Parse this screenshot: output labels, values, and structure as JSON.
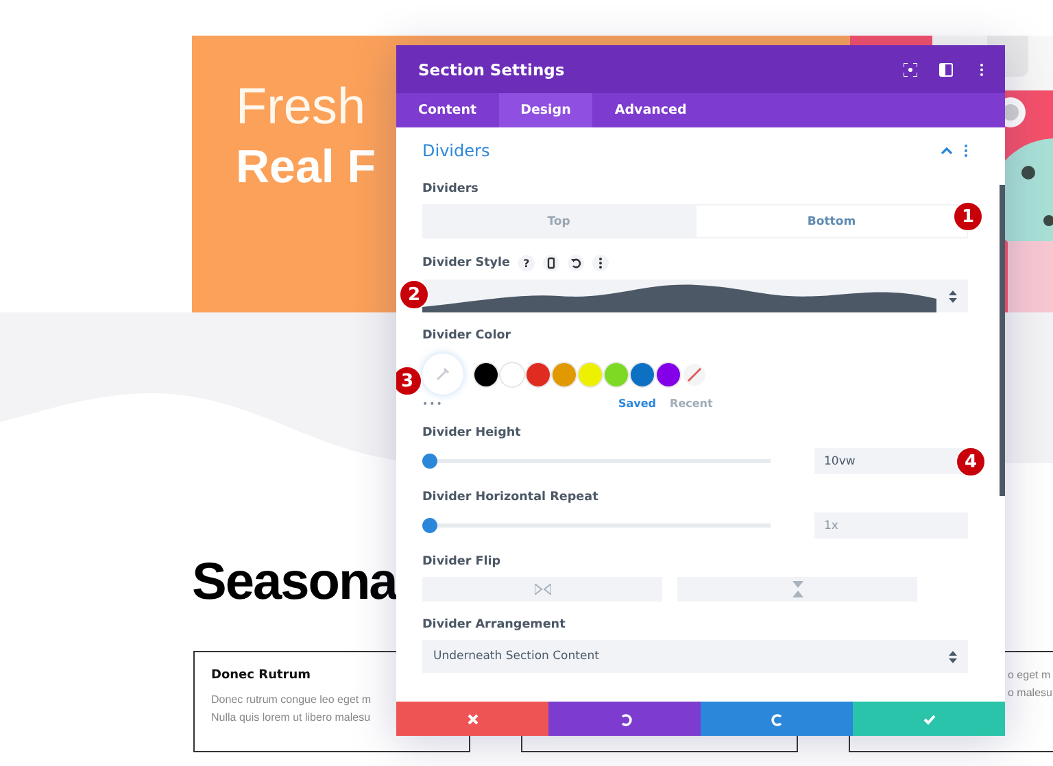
{
  "hero": {
    "title_light": "Fresh",
    "title_bold": "Real F"
  },
  "heading": "Seasona",
  "cards": [
    {
      "kind": "text",
      "title": "Donec Rutrum",
      "lines": [
        "Donec rutrum congue leo eget m",
        "Nulla quis lorem ut libero malesu"
      ]
    },
    {
      "kind": "blank"
    },
    {
      "kind": "text",
      "lines": [
        "o eget m",
        "o malesu"
      ]
    }
  ],
  "modal": {
    "title": "Section Settings",
    "tabs": [
      {
        "label": "Content",
        "selected": false
      },
      {
        "label": "Design",
        "selected": true
      },
      {
        "label": "Advanced",
        "selected": false
      }
    ],
    "section": {
      "title": "Dividers",
      "expanded": true
    },
    "fields": [
      {
        "kind": "toggle",
        "label": "Dividers",
        "options": [
          {
            "label": "Top",
            "selected": false
          },
          {
            "label": "Bottom",
            "selected": true
          }
        ],
        "marker": "1"
      },
      {
        "kind": "wave",
        "label": "Divider Style",
        "help": "?",
        "marker": "2"
      },
      {
        "kind": "colors",
        "label": "Divider Color",
        "more": "•••",
        "marker": "3",
        "swatches": [
          {
            "color": "#000000"
          },
          {
            "color": "#ffffff"
          },
          {
            "color": "#e02b20"
          },
          {
            "color": "#e09900"
          },
          {
            "color": "#edf000"
          },
          {
            "color": "#7cda24"
          },
          {
            "color": "#0c71c3"
          },
          {
            "color": "#8300e9"
          }
        ],
        "tabs": [
          {
            "label": "Saved",
            "selected": true
          },
          {
            "label": "Recent",
            "selected": false
          }
        ]
      },
      {
        "kind": "slider",
        "label": "Divider Height",
        "level": 0.02,
        "value": "10vw",
        "dim": false,
        "marker": "4"
      },
      {
        "kind": "slider",
        "label": "Divider Horizontal Repeat",
        "level": 0.0,
        "value": "1x",
        "dim": true
      },
      {
        "kind": "flip",
        "label": "Divider Flip"
      },
      {
        "kind": "select",
        "label": "Divider Arrangement",
        "value": "Underneath Section Content"
      }
    ]
  }
}
